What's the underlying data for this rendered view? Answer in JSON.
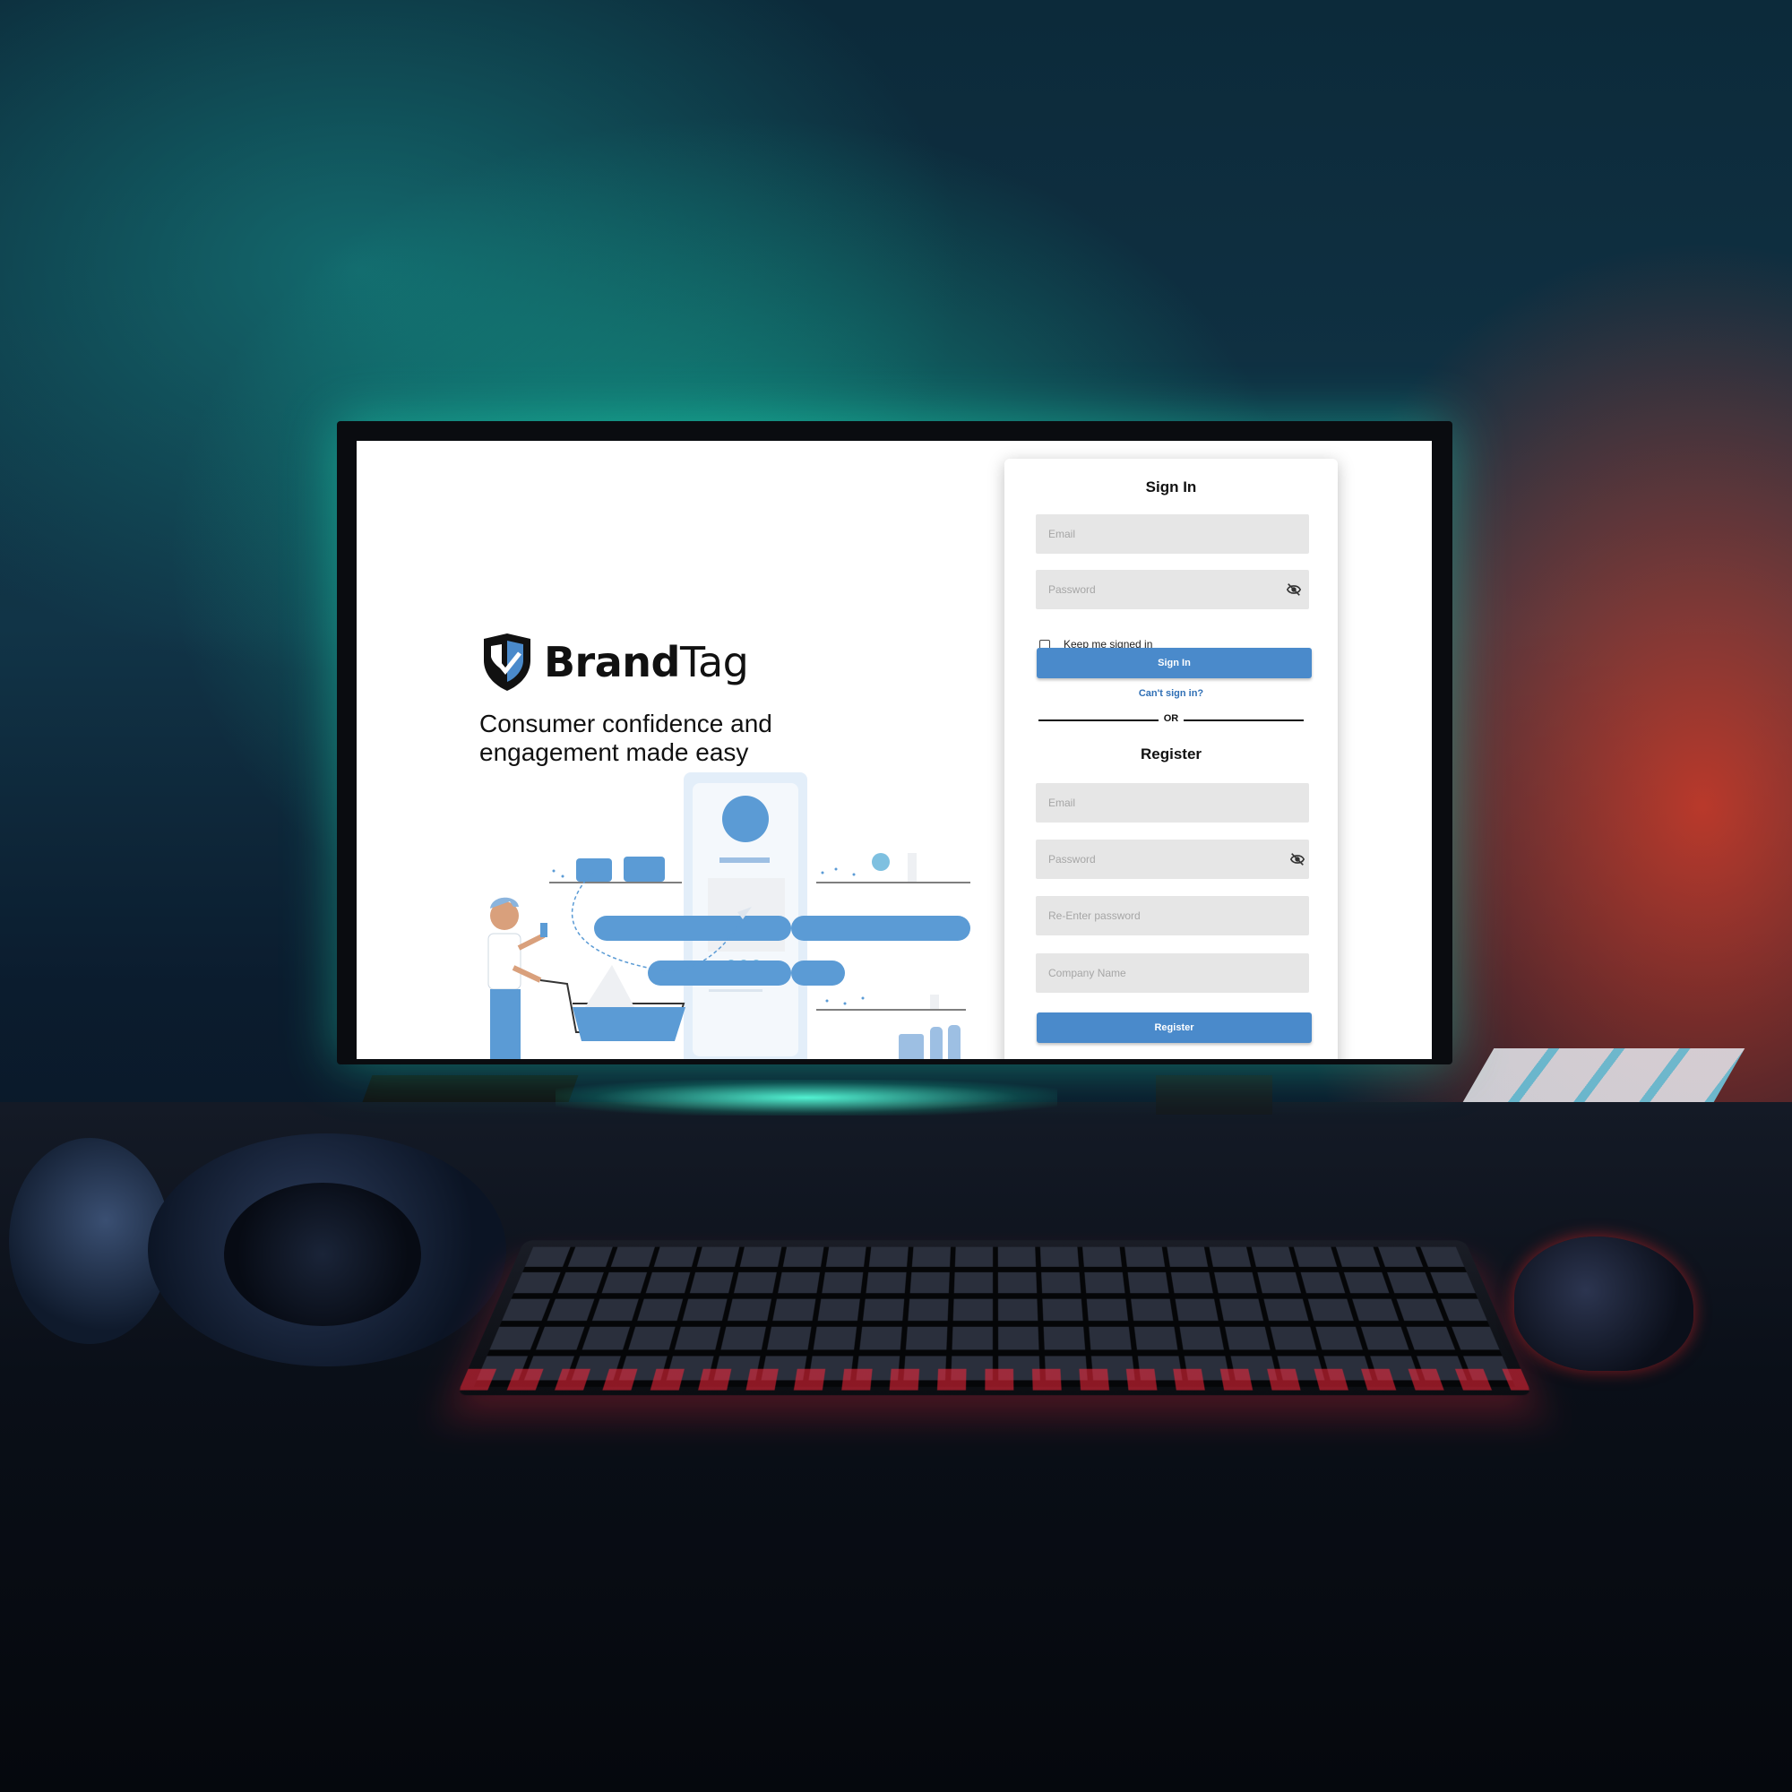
{
  "brand": {
    "name_bold": "Brand",
    "name_light": "Tag",
    "tagline": "Consumer confidence and engagement made easy"
  },
  "signin": {
    "title": "Sign In",
    "email_placeholder": "Email",
    "password_placeholder": "Password",
    "keep_signed_in": "Keep me signed in",
    "keep_signed_in_checked": false,
    "button": "Sign In",
    "cant_sign_in": "Can't sign in?"
  },
  "divider": {
    "label": "OR"
  },
  "register": {
    "title": "Register",
    "email_placeholder": "Email",
    "password_placeholder": "Password",
    "reenter_placeholder": "Re-Enter password",
    "company_placeholder": "Company Name",
    "button": "Register"
  },
  "icons": {
    "password_toggle": "eye-off-icon",
    "logo": "shield-logo-icon"
  },
  "colors": {
    "accent": "#4a8acb",
    "link": "#2f6fb5",
    "field_bg": "#e6e6e6",
    "illustration_blue": "#5b9bd5"
  }
}
